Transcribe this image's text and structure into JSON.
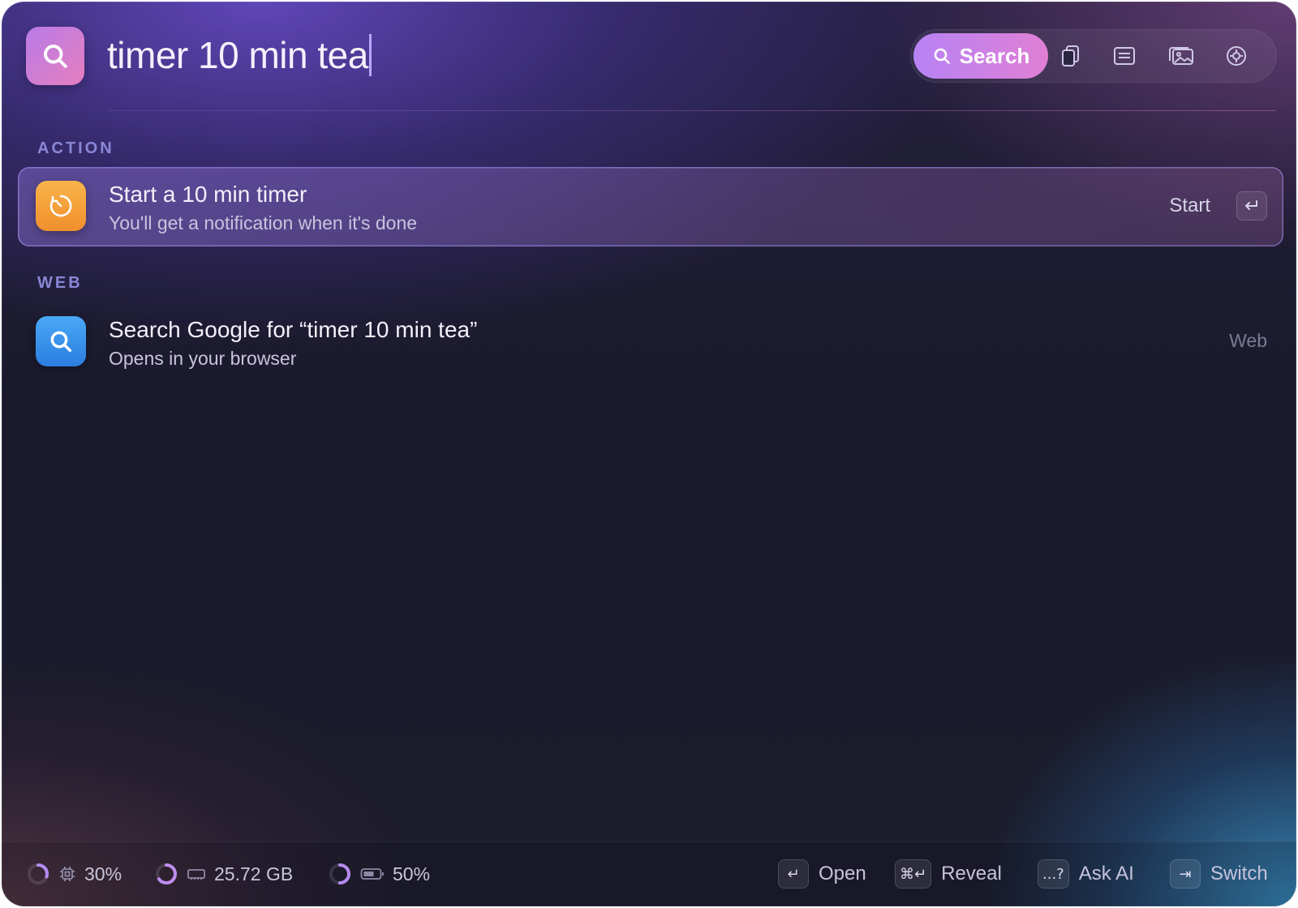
{
  "header": {
    "query": "timer 10 min tea",
    "toolbar": {
      "search_label": "Search",
      "icons": [
        "clipboard-icon",
        "notes-icon",
        "images-icon",
        "settings-icon"
      ]
    }
  },
  "sections": [
    {
      "label": "ACTION",
      "items": [
        {
          "title": "Start a 10 min timer",
          "subtitle": "You'll get a notification when it's done",
          "action": "Start",
          "icon": "timer-icon",
          "icon_color": "#f5a340"
        }
      ]
    },
    {
      "label": "WEB",
      "items": [
        {
          "title": "Search Google for “timer 10 min tea”",
          "subtitle": "Opens in your browser",
          "tag": "Web",
          "icon": "search-icon",
          "icon_color": "#2f8ff0"
        }
      ]
    }
  ],
  "footer": {
    "stats": [
      {
        "icon": "cpu-icon",
        "value": "30%",
        "level": 0.3
      },
      {
        "icon": "memory-icon",
        "value": "25.72 GB",
        "level": 0.65
      },
      {
        "icon": "battery-icon",
        "value": "50%",
        "level": 0.5
      }
    ],
    "hints": [
      {
        "key": "↵",
        "label": "Open"
      },
      {
        "key": "⌘↵",
        "label": "Reveal"
      },
      {
        "key": "...?",
        "label": "Ask AI"
      },
      {
        "key": "⇥",
        "label": "Switch"
      }
    ]
  },
  "colors": {
    "accent": "#b783f5",
    "accent_pink": "#e07fd4",
    "section_label": "#8a86d6"
  }
}
